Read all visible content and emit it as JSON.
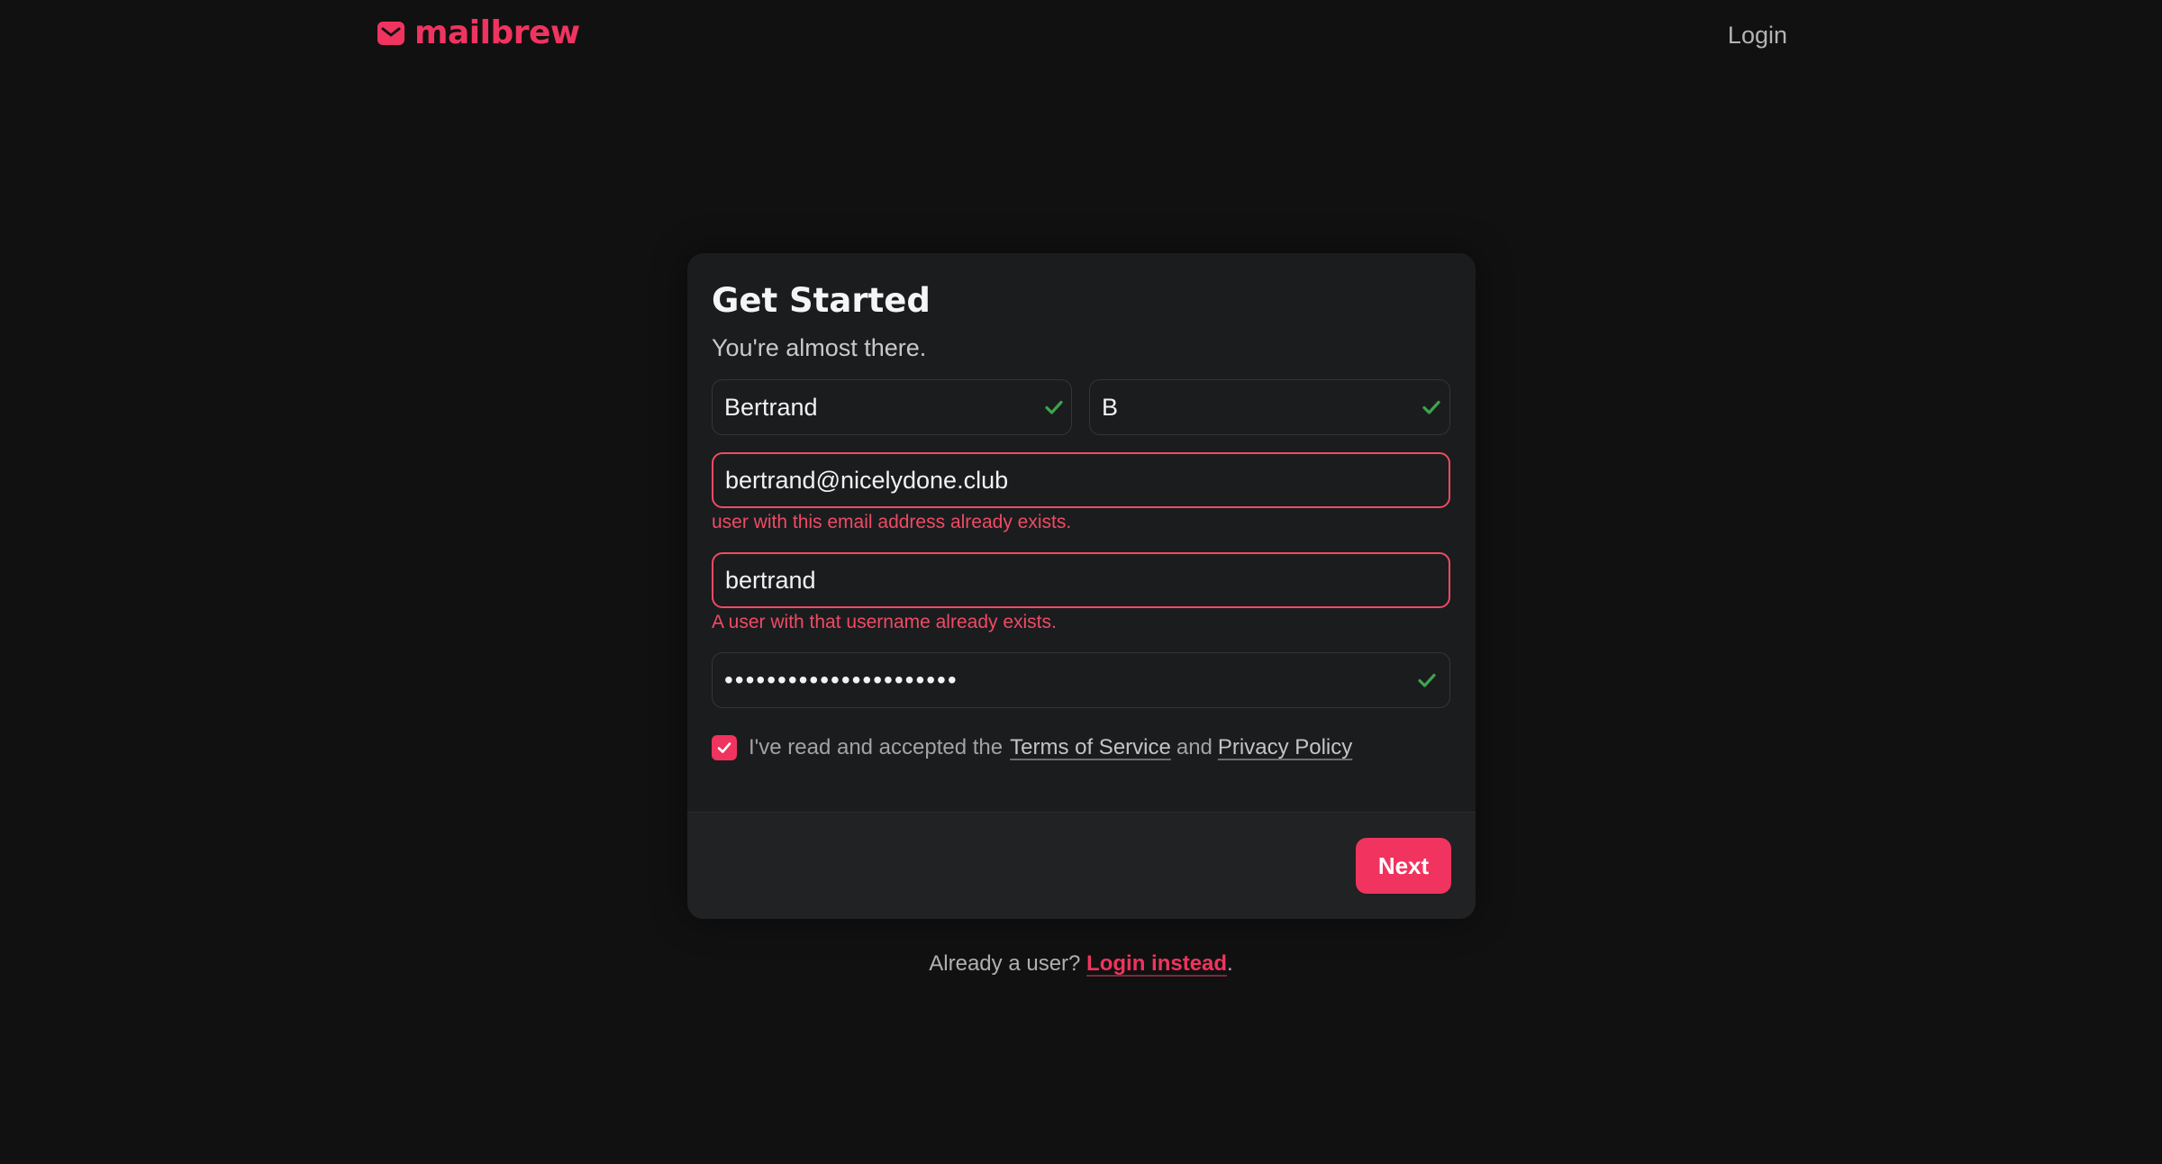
{
  "header": {
    "brand_name": "mailbrew",
    "brand_icon": "mail-envelope-icon",
    "login_link": "Login"
  },
  "card": {
    "title": "Get Started",
    "subtitle": "You're almost there."
  },
  "form": {
    "first_name": {
      "value": "Bertrand",
      "valid": true
    },
    "last_name": {
      "value": "B",
      "valid": true
    },
    "email": {
      "value": "bertrand@nicelydone.club",
      "error": "user with this email address already exists."
    },
    "username": {
      "value": "bertrand",
      "error": "A user with that username already exists."
    },
    "password": {
      "masked": "••••••••••••••••••••••",
      "valid": true
    },
    "terms": {
      "checked": true,
      "prefix": "I've read and accepted the",
      "tos_link": "Terms of Service",
      "conjunction": "and",
      "privacy_link": "Privacy Policy"
    },
    "next_button": "Next"
  },
  "footer": {
    "prompt": "Already a user?",
    "login_instead": "Login instead",
    "suffix": "."
  },
  "colors": {
    "background": "#111111",
    "card": "#1b1c1e",
    "accent": "#f0345f",
    "error": "#ef4b64",
    "success": "#3fa34d"
  }
}
